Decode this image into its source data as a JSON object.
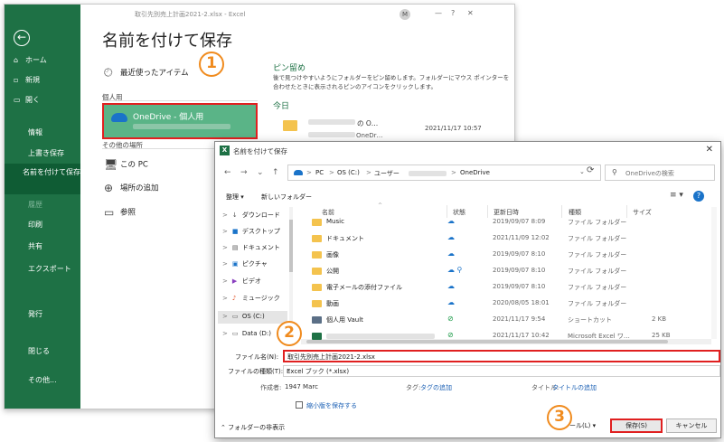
{
  "excel": {
    "window_title": "取引先別売上計画2021-2.xlsx  -  Excel",
    "user_initial": "M",
    "min_label": "—",
    "close_label": "✕",
    "help_label": "?",
    "back_icon": "←",
    "page_title": "名前を付けて保存",
    "nav": {
      "home": "ホーム",
      "new": "新規",
      "open": "開く",
      "info": "情報",
      "overwrite": "上書き保存",
      "save_as": "名前を付けて保存",
      "history": "履歴",
      "print": "印刷",
      "share": "共有",
      "export": "エクスポート",
      "publish": "発行",
      "close": "閉じる",
      "more": "その他..."
    },
    "locations": {
      "recent": "最近使ったアイテム",
      "personal_header": "個人用",
      "onedrive": "OneDrive - 個人用",
      "other_header": "その他の場所",
      "this_pc": "この PC",
      "add_place": "場所の追加",
      "browse": "参照"
    },
    "pinned": {
      "title": "ピン留め",
      "desc": "後で見つけやすいようにフォルダーをピン留めします。フォルダーにマウス ポインターを合わせたときに表示されるピンのアイコンをクリックします。",
      "today": "今日",
      "recent_item": "の O…",
      "recent_item_sub": "OneDr…",
      "recent_date": "2021/11/17 10:57"
    }
  },
  "dialog": {
    "title": "名前を付けて保存",
    "close_label": "✕",
    "back": "←",
    "forward": "→",
    "down": "⌄",
    "up": "↑",
    "breadcrumb": [
      "PC",
      "OS (C:)",
      "ユーザー",
      "OneDrive"
    ],
    "crumb_sep": ">",
    "addr_dropdown": "⌄",
    "refresh": "⟳",
    "search_placeholder": "OneDriveの検索",
    "organize": "整理 ▾",
    "new_folder": "新しいフォルダー",
    "view_icon": "≡ ▾",
    "help_icon": "?",
    "sort_arrow": "^",
    "nav_items": [
      {
        "arrow": ">",
        "icon": "↓",
        "label": "ダウンロード"
      },
      {
        "arrow": ">",
        "icon": "■",
        "label": "デスクトップ"
      },
      {
        "arrow": ">",
        "icon": "▤",
        "label": "ドキュメント"
      },
      {
        "arrow": ">",
        "icon": "▣",
        "label": "ピクチャ"
      },
      {
        "arrow": ">",
        "icon": "▶",
        "label": "ビデオ"
      },
      {
        "arrow": ">",
        "icon": "♪",
        "label": "ミュージック"
      },
      {
        "arrow": ">",
        "icon": "▭",
        "label": "OS (C:)"
      },
      {
        "arrow": ">",
        "icon": "▭",
        "label": "Data (D:)"
      }
    ],
    "columns": {
      "name": "名前",
      "status": "状態",
      "date": "更新日時",
      "type": "種類",
      "size": "サイズ"
    },
    "files": [
      {
        "name": "Music",
        "status": "☁",
        "date": "2019/09/07 8:09",
        "type": "ファイル フォルダー",
        "size": "",
        "kind": "folder"
      },
      {
        "name": "ドキュメント",
        "status": "☁",
        "date": "2021/11/09 12:02",
        "type": "ファイル フォルダー",
        "size": "",
        "kind": "folder"
      },
      {
        "name": "画像",
        "status": "☁",
        "date": "2019/09/07 8:10",
        "type": "ファイル フォルダー",
        "size": "",
        "kind": "folder"
      },
      {
        "name": "公開",
        "status": "☁ ⚲",
        "date": "2019/09/07 8:10",
        "type": "ファイル フォルダー",
        "size": "",
        "kind": "folder"
      },
      {
        "name": "電子メールの添付ファイル",
        "status": "☁",
        "date": "2019/09/07 8:10",
        "type": "ファイル フォルダー",
        "size": "",
        "kind": "folder"
      },
      {
        "name": "動画",
        "status": "☁",
        "date": "2020/08/05 18:01",
        "type": "ファイル フォルダー",
        "size": "",
        "kind": "folder"
      },
      {
        "name": "個人用 Vault",
        "status": "⊘",
        "date": "2021/11/17 9:54",
        "type": "ショートカット",
        "size": "2 KB",
        "kind": "vault"
      },
      {
        "name": "",
        "status": "⊘",
        "date": "2021/11/17 10:42",
        "type": "Microsoft Excel ワ…",
        "size": "25 KB",
        "kind": "excel"
      }
    ],
    "file_name_label": "ファイル名(N):",
    "file_name_value": "取引先別売上計画2021-2.xlsx",
    "file_type_label": "ファイルの種類(T):",
    "file_type_value": "Excel ブック (*.xlsx)",
    "authors_label": "作成者:",
    "authors_value": "1947 Marc",
    "tags_label": "タグ:",
    "tags_value": "タグの追加",
    "title_label": "タイトル:",
    "title_value": "タイトルの追加",
    "thumbnail_label": "縮小版を保存する",
    "hide_folders": "⌃ フォルダーの非表示",
    "tools_label": "ツール(L)  ▾",
    "save_button": "保存(S)",
    "cancel_button": "キャンセル"
  },
  "markers": [
    "1",
    "2",
    "3"
  ]
}
